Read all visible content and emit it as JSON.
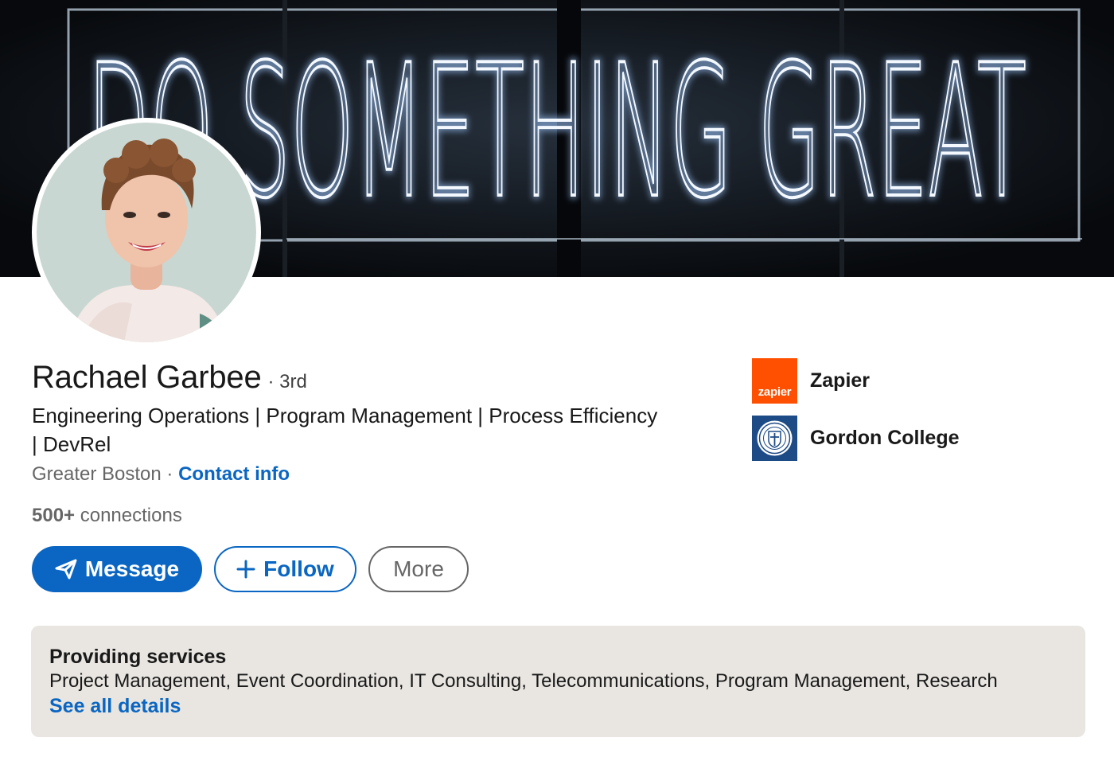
{
  "banner": {
    "neon_text": "DO SOMETHING GREAT",
    "background_color": "#0b0e12"
  },
  "profile": {
    "name": "Rachael Garbee",
    "degree": "· 3rd",
    "headline": "Engineering Operations | Program Management | Process Efficiency | DevRel",
    "location": "Greater Boston",
    "location_separator": " · ",
    "contact_link": "Contact info",
    "connections_count": "500+",
    "connections_label": " connections"
  },
  "actions": {
    "message_label": "Message",
    "follow_label": "Follow",
    "more_label": "More"
  },
  "organizations": [
    {
      "name": "Zapier",
      "logo_text": "zapier",
      "logo_color": "#ff4f00"
    },
    {
      "name": "Gordon College",
      "logo_color": "#1d4b86"
    }
  ],
  "services": {
    "title": "Providing services",
    "list": "Project Management, Event Coordination, IT Consulting, Telecommunications, Program Management, Research",
    "link": "See all details"
  },
  "colors": {
    "accent": "#0a66c2",
    "panel": "#e9e6e1",
    "secondary_text": "#666666"
  }
}
